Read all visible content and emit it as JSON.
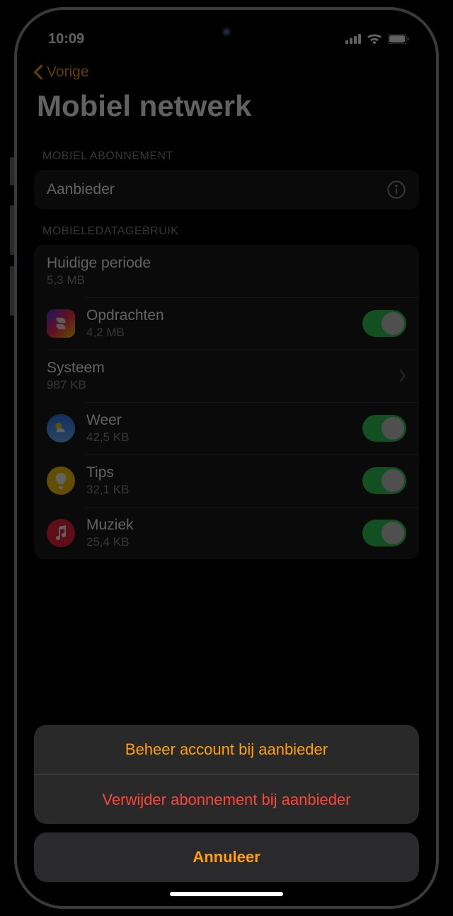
{
  "status": {
    "time": "10:09"
  },
  "nav": {
    "back": "Vorige",
    "title": "Mobiel netwerk"
  },
  "plan": {
    "header": "MOBIEL ABONNEMENT",
    "carrier": "Aanbieder"
  },
  "usage": {
    "header": "MOBIELEDATAGEBRUIK",
    "period": {
      "title": "Huidige periode",
      "value": "5,3 MB"
    },
    "apps": [
      {
        "name": "Opdrachten",
        "value": "4,2 MB",
        "icon": "shortcuts",
        "toggle": true
      },
      {
        "name": "Systeem",
        "value": "987 KB",
        "icon": null,
        "chevron": true
      },
      {
        "name": "Weer",
        "value": "42,5 KB",
        "icon": "weather",
        "toggle": true
      },
      {
        "name": "Tips",
        "value": "32,1 KB",
        "icon": "tips",
        "toggle": true
      },
      {
        "name": "Muziek",
        "value": "25,4 KB",
        "icon": "music",
        "toggle": true
      }
    ]
  },
  "sheet": {
    "manage": "Beheer account bij aanbieder",
    "remove": "Verwijder abonnement bij aanbieder",
    "cancel": "Annuleer"
  }
}
